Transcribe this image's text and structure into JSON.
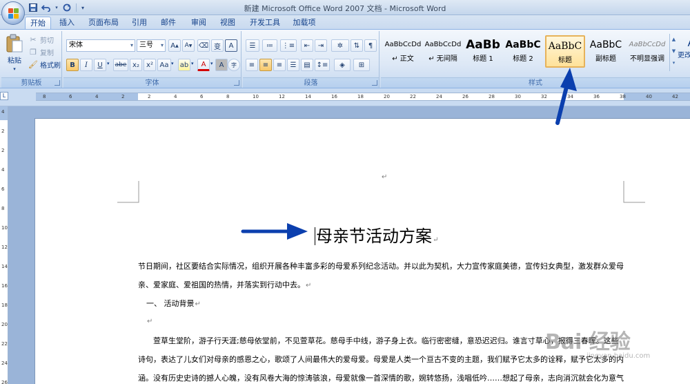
{
  "window": {
    "title": "新建 Microsoft Office Word 2007 文档 - Microsoft Word"
  },
  "qat": {
    "save": "save-icon",
    "undo": "undo-icon",
    "redo": "redo-icon",
    "customize": "▾"
  },
  "tabs": [
    {
      "label": "开始",
      "active": true
    },
    {
      "label": "插入"
    },
    {
      "label": "页面布局"
    },
    {
      "label": "引用"
    },
    {
      "label": "邮件"
    },
    {
      "label": "审阅"
    },
    {
      "label": "视图"
    },
    {
      "label": "开发工具"
    },
    {
      "label": "加载项"
    }
  ],
  "clipboard": {
    "paste": "粘贴",
    "cut": "剪切",
    "copy": "复制",
    "format_painter": "格式刷",
    "group": "剪贴板"
  },
  "font": {
    "name": "宋体",
    "size": "三号",
    "grow": "A",
    "shrink": "A",
    "clear": "清除格式",
    "phonetic": "变",
    "border": "A",
    "bold": "B",
    "italic": "I",
    "underline": "U",
    "strike": "abe",
    "subscript": "x₂",
    "superscript": "x²",
    "case": "Aa",
    "highlight": "ab",
    "color": "A",
    "shade": "A",
    "enclose": "字",
    "group": "字体"
  },
  "paragraph": {
    "group": "段落"
  },
  "styles": {
    "group": "样式",
    "change": "更改样式",
    "items": [
      {
        "sample": "AaBbCcDd",
        "name": "↵ 正文"
      },
      {
        "sample": "AaBbCcDd",
        "name": "↵ 无间隔"
      },
      {
        "sample": "AaBb",
        "name": "标题 1"
      },
      {
        "sample": "AaBbC",
        "name": "标题 2"
      },
      {
        "sample": "AaBbC",
        "name": "标题",
        "selected": true
      },
      {
        "sample": "AaBbC",
        "name": "副标题"
      },
      {
        "sample": "AaBbCcDd",
        "name": "不明显强调"
      }
    ]
  },
  "ruler": {
    "corner": "L",
    "ticks": [
      "8",
      "6",
      "4",
      "2",
      "2",
      "4",
      "6",
      "8",
      "10",
      "12",
      "14",
      "16",
      "18",
      "20",
      "22",
      "24",
      "26",
      "28",
      "30",
      "32",
      "34",
      "36",
      "38",
      "40",
      "42"
    ]
  },
  "vruler": {
    "ticks": [
      "4",
      "2",
      "2",
      "4",
      "6",
      "8",
      "10",
      "12",
      "14",
      "16",
      "18",
      "20",
      "22",
      "24",
      "26"
    ]
  },
  "document": {
    "empty_mark": "↵",
    "heading": "母亲节活动方案",
    "paragraphs": [
      "节日期间，社区要结合实际情况，组织开展各种丰富多彩的母爱系列纪念活动。并以此为契机，大力宣传家庭美德，宣传妇女典型，激发群众爱母",
      "亲、爱家庭、爱祖国的热情，并落实到行动中去。",
      "一、 活动背景",
      "",
      "萱草生堂阶，游子行天涯;慈母依堂前，不见萱草花。慈母手中线，游子身上衣。临行密密缝，意恐迟迟归。谁言寸草心，报得三春晖。这些",
      "诗句，表达了儿女们对母亲的感恩之心，歌颂了人间最伟大的爱母爱。母爱是人类一个亘古不变的主题，我们赋予它太多的诠释，赋予它太多的内",
      "涵。没有历史史诗的撼人心魄，没有风卷大海的惊涛骇浪，母爱就像一首深情的歌，婉转悠扬，浅唱低吟……想起了母亲，志向消沉就会化为意气"
    ]
  },
  "watermark": {
    "text": "Bai 经验",
    "sub": "jingyan.baidu.com"
  },
  "colors": {
    "accent": "#0b3fae",
    "selected_style": "#ffe29a"
  }
}
